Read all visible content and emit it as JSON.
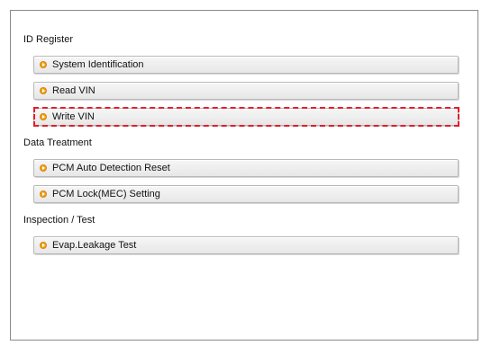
{
  "sections": [
    {
      "title": "ID Register",
      "items": [
        "System Identification",
        "Read VIN",
        "Write VIN"
      ]
    },
    {
      "title": "Data Treatment",
      "items": [
        "PCM Auto Detection Reset",
        "PCM Lock(MEC) Setting"
      ]
    },
    {
      "title": "Inspection / Test",
      "items": [
        "Evap.Leakage Test"
      ]
    }
  ],
  "highlighted_item": "Write VIN",
  "colors": {
    "highlight": "#e01e2c",
    "bullet": "#f3a21b"
  }
}
